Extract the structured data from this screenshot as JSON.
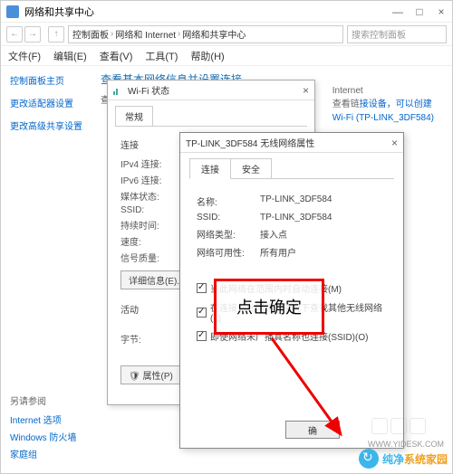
{
  "window": {
    "title": "网络和共享中心",
    "min": "—",
    "max": "□",
    "close": "×"
  },
  "nav": {
    "back": "←",
    "fwd": "→",
    "up": "↑",
    "bc1": "控制面板",
    "bc2": "网络和 Internet",
    "bc3": "网络和共享中心",
    "sep": "›",
    "search_ph": "搜索控制面板"
  },
  "menu": {
    "file": "文件(F)",
    "edit": "编辑(E)",
    "view": "查看(V)",
    "tools": "工具(T)",
    "help": "帮助(H)"
  },
  "sidebar": {
    "home": "控制面板主页",
    "adapter": "更改适配器设置",
    "sharing": "更改高级共享设置"
  },
  "main": {
    "heading": "查看基本网络信息并设置连接",
    "sub": "查看活动网络"
  },
  "right": {
    "l1": "Internet",
    "l2g": "查看链",
    "l2b": "接设备，可以创建",
    "l3b": "Wi-Fi (TP-LINK_3DF584)"
  },
  "footer": {
    "hdr": "另请参阅",
    "a": "Internet 选项",
    "b": "Windows 防火墙",
    "c": "家庭组"
  },
  "wifistat": {
    "title": "Wi-Fi 状态",
    "tab": "常规",
    "sec_conn": "连接",
    "ipv4": "IPv4 连接:",
    "ipv6": "IPv6 连接:",
    "media": "媒体状态:",
    "ssid": "SSID:",
    "dur": "持续时间:",
    "speed": "速度:",
    "sig": "信号质量:",
    "btn_detail": "详细信息(E)...",
    "sec_act": "活动",
    "bytes": "字节:",
    "btn_prop": "属性(P)"
  },
  "prop": {
    "title": "TP-LINK_3DF584 无线网络属性",
    "tab_conn": "连接",
    "tab_sec": "安全",
    "name_k": "名称:",
    "name_v": "TP-LINK_3DF584",
    "ssid_k": "SSID:",
    "ssid_v": "TP-LINK_3DF584",
    "type_k": "网络类型:",
    "type_v": "接入点",
    "avail_k": "网络可用性:",
    "avail_v": "所有用户",
    "cb1": "当此网络在范围内时自动连接(M)",
    "cb2": "在连接到此网络的情况下查找其他无线网络(L)",
    "cb3": "即使网络未广播其名称也连接(SSID)(O)",
    "ok": "确"
  },
  "anno": {
    "text": "点击确定"
  },
  "wm": {
    "a": "纯净",
    "b": "系统家园",
    "url": "WWW.YIDESK.COM"
  }
}
